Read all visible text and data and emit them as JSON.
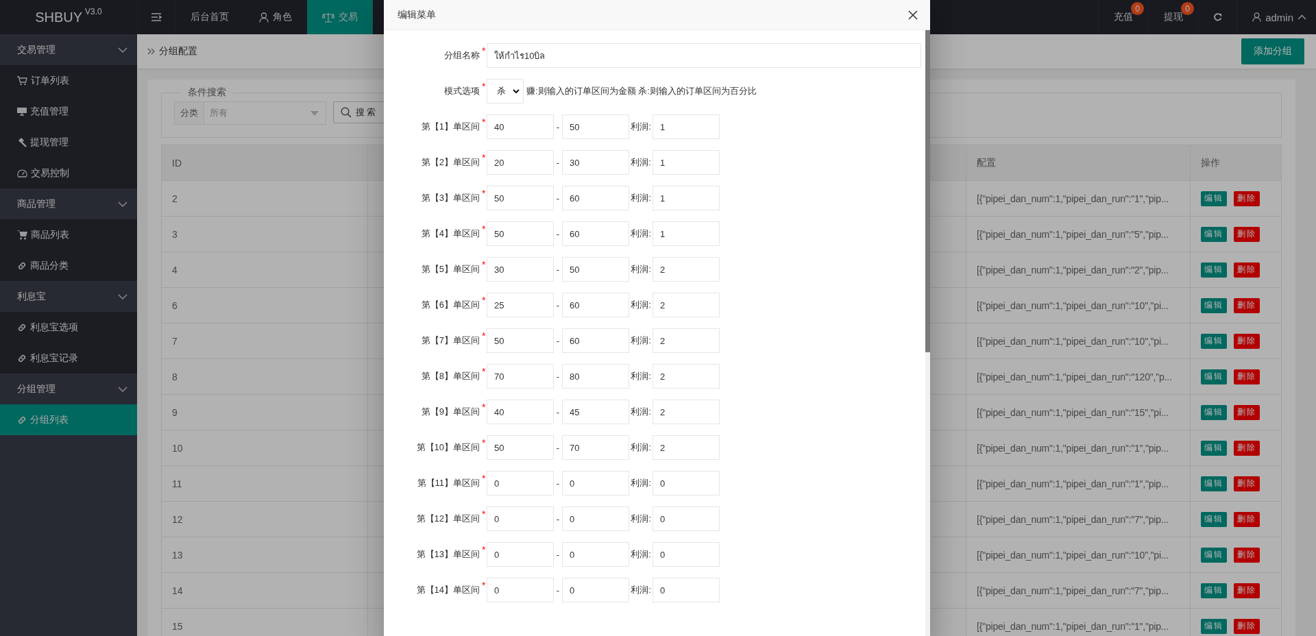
{
  "header": {
    "logo": "SHBUY",
    "version": "V3.0",
    "nav": [
      {
        "label": "后台首页",
        "selected": false
      },
      {
        "label": "角色",
        "selected": false
      },
      {
        "label": "交易",
        "selected": true
      }
    ],
    "actions": [
      {
        "label": "充值",
        "badge": "0"
      },
      {
        "label": "提现",
        "badge": "0"
      }
    ],
    "user": "admin"
  },
  "sidebar": {
    "groups": [
      {
        "label": "交易管理",
        "expanded": true,
        "items": [
          {
            "label": "订单列表",
            "selected": false
          },
          {
            "label": "充值管理",
            "selected": false
          },
          {
            "label": "提现管理",
            "selected": false
          },
          {
            "label": "交易控制",
            "selected": false
          }
        ]
      },
      {
        "label": "商品管理",
        "expanded": true,
        "items": [
          {
            "label": "商品列表",
            "selected": false
          },
          {
            "label": "商品分类",
            "selected": false
          }
        ]
      },
      {
        "label": "利息宝",
        "expanded": true,
        "items": [
          {
            "label": "利息宝选项",
            "selected": false
          },
          {
            "label": "利息宝记录",
            "selected": false
          }
        ]
      },
      {
        "label": "分组管理",
        "expanded": true,
        "items": [
          {
            "label": "分组列表",
            "selected": true
          }
        ]
      }
    ]
  },
  "breadcrumb": "分组配置",
  "add_button": "添加分组",
  "search": {
    "legend": "条件搜索",
    "filter_label": "分类",
    "filter_value": "所有",
    "button": "搜索"
  },
  "table": {
    "columns": [
      "ID",
      "配置",
      "操作"
    ],
    "rows": [
      {
        "id": "2",
        "config": "[{\"pipei_dan_num\":1,\"pipei_dan_run\":\"1\",\"pip...",
        "edit": "编辑",
        "delete": "删除"
      },
      {
        "id": "3",
        "config": "[{\"pipei_dan_num\":1,\"pipei_dan_run\":\"5\",\"pip...",
        "edit": "编辑",
        "delete": "删除"
      },
      {
        "id": "4",
        "config": "[{\"pipei_dan_num\":1,\"pipei_dan_run\":\"2\",\"pip...",
        "edit": "编辑",
        "delete": "删除"
      },
      {
        "id": "6",
        "config": "[{\"pipei_dan_num\":1,\"pipei_dan_run\":\"10\",\"pi...",
        "edit": "编辑",
        "delete": "删除"
      },
      {
        "id": "7",
        "config": "[{\"pipei_dan_num\":1,\"pipei_dan_run\":\"10\",\"pi...",
        "edit": "编辑",
        "delete": "删除"
      },
      {
        "id": "8",
        "config": "[{\"pipei_dan_num\":1,\"pipei_dan_run\":\"120\",\"p...",
        "edit": "编辑",
        "delete": "删除"
      },
      {
        "id": "9",
        "config": "[{\"pipei_dan_num\":1,\"pipei_dan_run\":\"15\",\"pi...",
        "edit": "编辑",
        "delete": "删除"
      },
      {
        "id": "10",
        "config": "[{\"pipei_dan_num\":1,\"pipei_dan_run\":\"1\",\"pip...",
        "edit": "编辑",
        "delete": "删除"
      },
      {
        "id": "11",
        "config": "[{\"pipei_dan_num\":1,\"pipei_dan_run\":\"1\",\"pip...",
        "edit": "编辑",
        "delete": "删除"
      },
      {
        "id": "12",
        "config": "[{\"pipei_dan_num\":1,\"pipei_dan_run\":\"7\",\"pip...",
        "edit": "编辑",
        "delete": "删除"
      },
      {
        "id": "13",
        "config": "[{\"pipei_dan_num\":1,\"pipei_dan_run\":\"10\",\"pi...",
        "edit": "编辑",
        "delete": "删除"
      },
      {
        "id": "14",
        "config": "[{\"pipei_dan_num\":1,\"pipei_dan_run\":\"7\",\"pip...",
        "edit": "编辑",
        "delete": "删除"
      },
      {
        "id": "15",
        "config": "[{\"pipei_dan_num\":1,\"pipei_dan_run\":\"1\",\"pip...",
        "edit": "编辑",
        "delete": "删除"
      }
    ]
  },
  "modal": {
    "title": "编辑菜单",
    "name_field": {
      "label": "分组名称",
      "required_mark": "*",
      "value": "ให้กำไร10บิล"
    },
    "mode_field": {
      "label": "模式选项",
      "required_mark": "*",
      "value": "杀",
      "hint": "赚:则输入的订单区间为金额 杀:则输入的订单区间为百分比"
    },
    "intervals": [
      {
        "label": "第【1】单区间",
        "required_mark": "*",
        "from": "40",
        "dash": "-",
        "to": "50",
        "profit_label": "利润:",
        "profit": "1"
      },
      {
        "label": "第【2】单区间",
        "required_mark": "*",
        "from": "20",
        "dash": "-",
        "to": "30",
        "profit_label": "利润:",
        "profit": "1"
      },
      {
        "label": "第【3】单区间",
        "required_mark": "*",
        "from": "50",
        "dash": "-",
        "to": "60",
        "profit_label": "利润:",
        "profit": "1"
      },
      {
        "label": "第【4】单区间",
        "required_mark": "*",
        "from": "50",
        "dash": "-",
        "to": "60",
        "profit_label": "利润:",
        "profit": "1"
      },
      {
        "label": "第【5】单区间",
        "required_mark": "*",
        "from": "30",
        "dash": "-",
        "to": "50",
        "profit_label": "利润:",
        "profit": "2"
      },
      {
        "label": "第【6】单区间",
        "required_mark": "*",
        "from": "25",
        "dash": "-",
        "to": "60",
        "profit_label": "利润:",
        "profit": "2"
      },
      {
        "label": "第【7】单区间",
        "required_mark": "*",
        "from": "50",
        "dash": "-",
        "to": "60",
        "profit_label": "利润:",
        "profit": "2"
      },
      {
        "label": "第【8】单区间",
        "required_mark": "*",
        "from": "70",
        "dash": "-",
        "to": "80",
        "profit_label": "利润:",
        "profit": "2"
      },
      {
        "label": "第【9】单区间",
        "required_mark": "*",
        "from": "40",
        "dash": "-",
        "to": "45",
        "profit_label": "利润:",
        "profit": "2"
      },
      {
        "label": "第【10】单区间",
        "required_mark": "*",
        "from": "50",
        "dash": "-",
        "to": "70",
        "profit_label": "利润:",
        "profit": "2"
      },
      {
        "label": "第【11】单区间",
        "required_mark": "*",
        "from": "0",
        "dash": "-",
        "to": "0",
        "profit_label": "利润:",
        "profit": "0"
      },
      {
        "label": "第【12】单区间",
        "required_mark": "*",
        "from": "0",
        "dash": "-",
        "to": "0",
        "profit_label": "利润:",
        "profit": "0"
      },
      {
        "label": "第【13】单区间",
        "required_mark": "*",
        "from": "0",
        "dash": "-",
        "to": "0",
        "profit_label": "利润:",
        "profit": "0"
      },
      {
        "label": "第【14】单区间",
        "required_mark": "*",
        "from": "0",
        "dash": "-",
        "to": "0",
        "profit_label": "利润:",
        "profit": "0"
      }
    ]
  }
}
